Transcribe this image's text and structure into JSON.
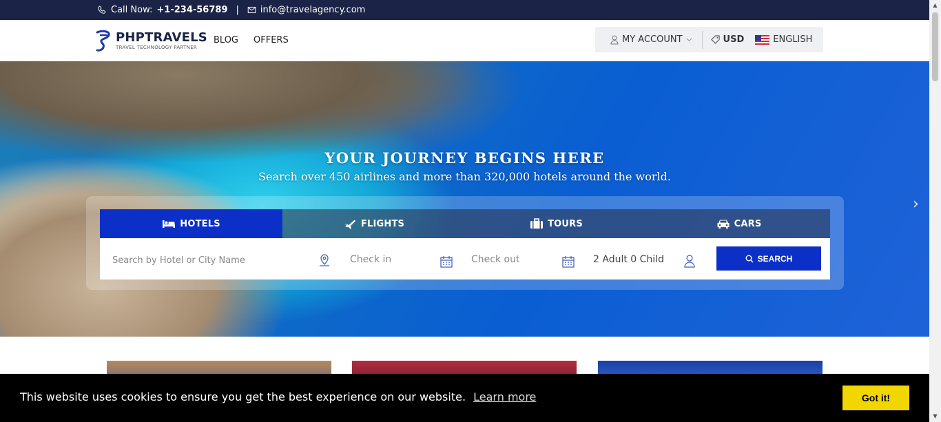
{
  "topbar": {
    "call_label": "Call Now:",
    "phone": "+1-234-56789",
    "separator": "|",
    "email": "info@travelagency.com"
  },
  "header": {
    "logo_name": "PHPTRAVELS",
    "logo_tagline": "TRAVEL TECHNOLOGY PARTNER",
    "nav": [
      "BLOG",
      "OFFERS"
    ],
    "account_label": "MY ACCOUNT",
    "currency": "USD",
    "language": "ENGLISH"
  },
  "hero": {
    "title": "YOUR JOURNEY BEGINS HERE",
    "subtitle": "Search over 450 airlines and more than 320,000 hotels around the world.",
    "next_arrow": "›"
  },
  "search": {
    "tabs": [
      {
        "label": "HOTELS",
        "icon": "bed-icon"
      },
      {
        "label": "FLIGHTS",
        "icon": "plane-icon"
      },
      {
        "label": "TOURS",
        "icon": "suitcase-icon"
      },
      {
        "label": "CARS",
        "icon": "car-icon"
      }
    ],
    "city_placeholder": "Search by Hotel or City Name",
    "checkin_placeholder": "Check in",
    "checkout_placeholder": "Check out",
    "guests_value": "2 Adult 0 Child",
    "button_label": "SEARCH"
  },
  "cookie": {
    "message": "This website uses cookies to ensure you get the best experience on our website.",
    "learn_more": "Learn more",
    "accept": "Got it!"
  },
  "colors": {
    "topbar": "#1b2446",
    "primary": "#0b2fc7",
    "cookie_button": "#f1d600"
  }
}
